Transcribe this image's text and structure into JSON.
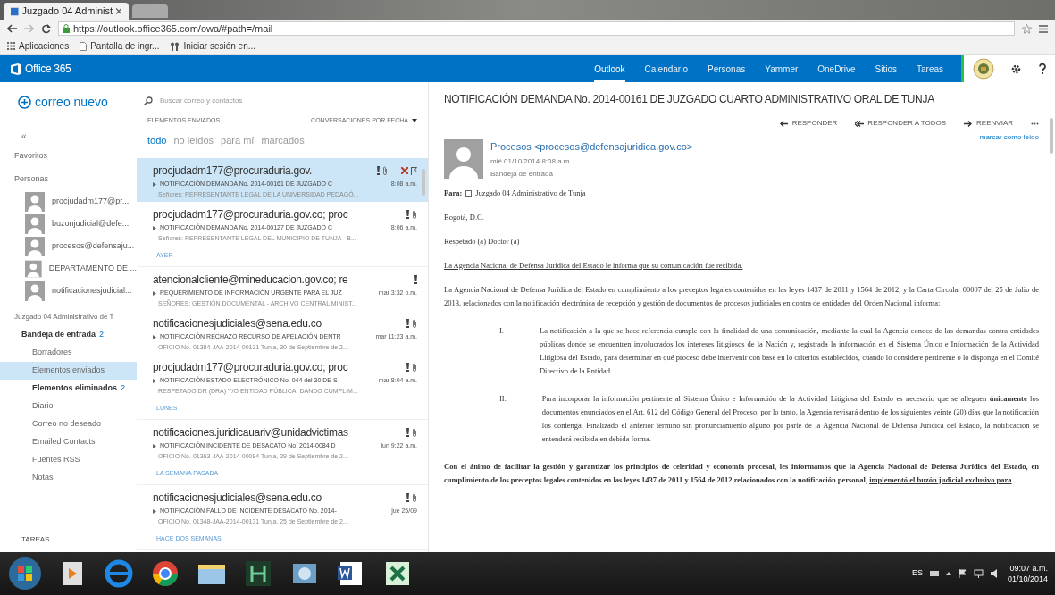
{
  "browser": {
    "tab_title": "Juzgado 04 Administ",
    "url": "https://outlook.office365.com/owa/#path=/mail",
    "bookmarks": [
      "Aplicaciones",
      "Pantalla de ingr...",
      "Iniciar sesión en..."
    ]
  },
  "suite_bar": {
    "brand": "Office 365",
    "nav": [
      {
        "label": "Outlook",
        "selected": true
      },
      {
        "label": "Calendario",
        "selected": false
      },
      {
        "label": "Personas",
        "selected": false
      },
      {
        "label": "Yammer",
        "selected": false
      },
      {
        "label": "OneDrive",
        "selected": false
      },
      {
        "label": "Sitios",
        "selected": false
      },
      {
        "label": "Tareas",
        "selected": false
      }
    ]
  },
  "sidebar": {
    "new_mail": "correo nuevo",
    "collapse": "«",
    "favorites": "Favoritos",
    "people_header": "Personas",
    "people": [
      "procjudadm177@pr...",
      "buzonjudicial@defe...",
      "procesos@defensaju...",
      "DEPARTAMENTO DE ...",
      "notificacionesjudicial..."
    ],
    "mailbox": "Juzgado 04 Administrativo de T",
    "folders": [
      {
        "label": "Bandeja de entrada",
        "count": "2",
        "bold": true,
        "selected": false,
        "top": true
      },
      {
        "label": "Borradores",
        "bold": false,
        "selected": false,
        "top": false
      },
      {
        "label": "Elementos enviados",
        "bold": false,
        "selected": true,
        "top": false
      },
      {
        "label": "Elementos eliminados",
        "count": "2",
        "bold": true,
        "selected": false,
        "top": false
      },
      {
        "label": "Diario",
        "bold": false,
        "selected": false,
        "top": false
      },
      {
        "label": "Correo no deseado",
        "bold": false,
        "selected": false,
        "top": false
      },
      {
        "label": "Emailed Contacts",
        "bold": false,
        "selected": false,
        "top": false
      },
      {
        "label": "Fuentes RSS",
        "bold": false,
        "selected": false,
        "top": false
      },
      {
        "label": "Notas",
        "bold": false,
        "selected": false,
        "top": false
      }
    ],
    "footer": "TAREAS"
  },
  "message_list": {
    "search_placeholder": "Buscar correo y contactos",
    "folder_title": "ELEMENTOS ENVIADOS",
    "sort": "CONVERSACIONES POR FECHA",
    "filters": [
      {
        "label": "todo",
        "selected": true
      },
      {
        "label": "no leídos",
        "selected": false
      },
      {
        "label": "para mí",
        "selected": false
      },
      {
        "label": "marcados",
        "selected": false
      }
    ],
    "items": [
      {
        "kind": "message",
        "sender": "procjudadm177@procuraduria.gov.",
        "subject": "NOTIFICACIÓN DEMANDA No. 2014-00161 DE JUZGADO C",
        "preview": "Señores: REPRESENTANTE LEGAL DE LA UNIVERSIDAD PEDAGÓ...",
        "time": "8:08 a.m.",
        "important": true,
        "attachment": true,
        "selected": true
      },
      {
        "kind": "message",
        "sender": "procjudadm177@procuraduria.gov.co; proc",
        "subject": "NOTIFICACIÓN DEMANDA No. 2014-00127 DE JUZGADO C",
        "preview": "Señores: REPRESENTANTE LEGAL DEL MUNICIPIO DE TUNJA - B...",
        "time": "8:06 a.m.",
        "important": true,
        "attachment": true,
        "selected": false
      },
      {
        "kind": "group",
        "label": "AYER"
      },
      {
        "kind": "message",
        "sender": "atencionalcliente@mineducacion.gov.co; re",
        "subject": "REQUERIMIENTO DE INFORMACIÓN URGENTE PARA EL JUZ",
        "preview": "SEÑORES: GESTIÓN DOCUMENTAL - ARCHIVO CENTRAL MINIST...",
        "time": "mar 3:32 p.m.",
        "important": true,
        "attachment": false,
        "selected": false
      },
      {
        "kind": "message",
        "sender": "notificacionesjudiciales@sena.edu.co",
        "subject": "NOTIFICACIÓN RECHAZO RECURSO DE APELACIÓN DENTR",
        "preview": "OFICIO No. 01384-JAA-2014-00131 Tunja, 30 de Septiembre de 2...",
        "time": "mar 11:23 a.m.",
        "important": true,
        "attachment": true,
        "selected": false
      },
      {
        "kind": "message",
        "sender": "procjudadm177@procuraduria.gov.co; proc",
        "subject": "NOTIFICACIÓN ESTADO ELECTRÓNICO No. 044 del 30 DE S",
        "preview": "RESPETADO DR (DRA) Y/O ENTIDAD PÚBLICA: DANDO CUMPLIM...",
        "time": "mar 8:04 a.m.",
        "important": true,
        "attachment": true,
        "selected": false
      },
      {
        "kind": "group",
        "label": "LUNES"
      },
      {
        "kind": "message",
        "sender": "notificaciones.juridicauariv@unidadvictimas",
        "subject": "NOTIFICACIÓN INCIDENTE DE DESACATO No. 2014-0084 D",
        "preview": "OFICIO No. 01363-JAA-2014-00084 Tunja, 29 de Septiembre de 2...",
        "time": "lun 9:22 a.m.",
        "important": true,
        "attachment": true,
        "selected": false
      },
      {
        "kind": "group",
        "label": "LA SEMANA PASADA"
      },
      {
        "kind": "message",
        "sender": "notificacionesjudiciales@sena.edu.co",
        "subject": "NOTIFICACIÓN FALLO DE INCIDENTE DESACATO No. 2014-",
        "preview": "OFICIO No. 01348-JAA-2014-00131 Tunja, 25 de Septiembre de 2...",
        "time": "jue 25/09",
        "important": true,
        "attachment": true,
        "selected": false
      },
      {
        "kind": "group",
        "label": "HACE DOS SEMANAS"
      }
    ]
  },
  "reading_pane": {
    "subject": "NOTIFICACIÓN DEMANDA No. 2014-00161 DE JUZGADO CUARTO ADMINISTRATIVO ORAL DE TUNJA",
    "actions": [
      "RESPONDER",
      "RESPONDER A TODOS",
      "REENVIAR"
    ],
    "mark_read": "marcar como leído",
    "sender": "Procesos <procesos@defensajuridica.gov.co>",
    "date": "mié 01/10/2014 8:08 a.m.",
    "folder": "Bandeja de entrada",
    "to_label": "Para:",
    "to": "Juzgado 04 Administrativo de Tunja",
    "body": [
      {
        "kind": "line",
        "text": "Bogotá, D.C."
      },
      {
        "kind": "line",
        "text": "Respetado (a) Doctor (a)"
      },
      {
        "kind": "underlined",
        "text": "La Agencia Nacional de Defensa Jurídica del Estado le informa que su comunicación fue recibida."
      },
      {
        "kind": "para",
        "text": "La Agencia Nacional de Defensa Jurídica del Estado en cumplimiento a los preceptos legales contenidos en las leyes 1437 de 2011 y 1564 de 2012, y la Carta Circular 00007 del 25 de Julio de 2013, relacionados con la notificación electrónica de recepción y gestión de documentos de procesos judiciales en contra de entidades del Orden Nacional informa:"
      },
      {
        "kind": "item",
        "number": "I.",
        "text": "La notificación a la que se hace referencia cumple con la finalidad de una comunicación, mediante la cual la Agencia conoce de las demandas contra entidades públicas donde se encuentren involucrados los intereses litigiosos de la Nación y, registrada la información en el Sistema Único e Información de la Actividad Litigiosa del Estado, para determinar en qué proceso debe intervenir con base en lo criterios establecidos, cuando lo considere pertinente o lo disponga en el Comité Directivo de la Entidad."
      },
      {
        "kind": "item",
        "number": "II.",
        "text": "Para incorporar la información pertinente al Sistema Único e Información de la Actividad Litigiosa del Estado es necesario que se alleguen **únicamente** los documentos enunciados en el Art. 612 del Código General del Proceso, por lo tanto, la Agencia revisará dentro de los siguientes veinte (20) días que la notificación los contenga. Finalizado el anterior término sin pronunciamiento alguno por parte de la Agencia Nacional de Defensa Jurídica del Estado, la notificación se entenderá recibida en debida forma."
      },
      {
        "kind": "bold",
        "text": "Con el ánimo de facilitar la gestión y garantizar los principios de celeridad y economía procesal, les informamos que la Agencia Nacional de Defensa Jurídica del Estado, en cumplimiento de los preceptos legales contenidos en las leyes 1437 de 2011 y 1564 de 2012 relacionados con la notificación personal,",
        "link": "implementó el buzón judicial exclusivo para"
      }
    ]
  },
  "taskbar": {
    "language": "ES",
    "time": "09:07 a.m.",
    "date": "01/10/2014"
  }
}
